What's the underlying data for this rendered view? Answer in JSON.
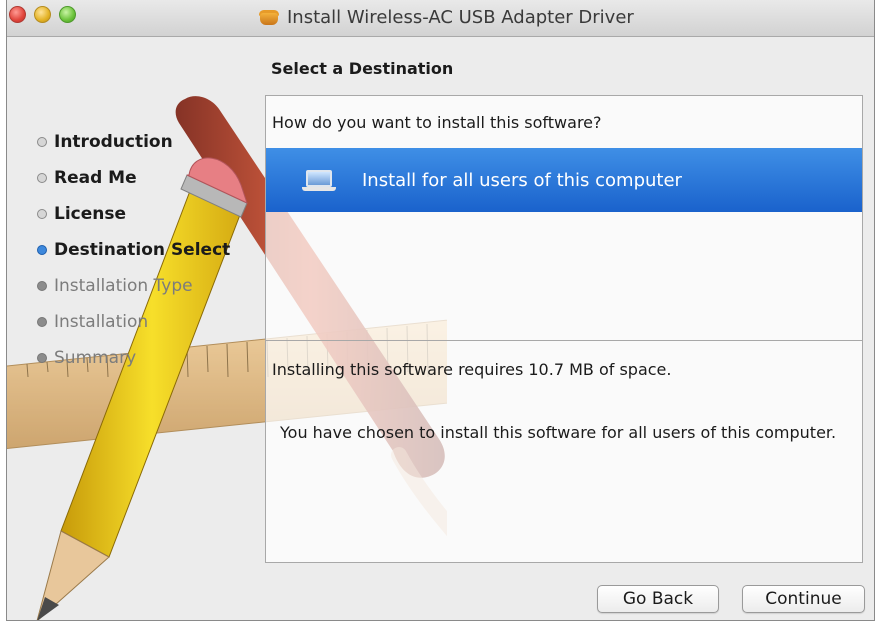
{
  "window": {
    "title": "Install Wireless-AC USB Adapter Driver",
    "title_icon": "package-icon"
  },
  "sidebar": {
    "steps": [
      {
        "label": "Introduction",
        "state": "done"
      },
      {
        "label": "Read Me",
        "state": "done"
      },
      {
        "label": "License",
        "state": "done"
      },
      {
        "label": "Destination Select",
        "state": "current"
      },
      {
        "label": "Installation Type",
        "state": "future"
      },
      {
        "label": "Installation",
        "state": "future"
      },
      {
        "label": "Summary",
        "state": "future"
      }
    ]
  },
  "main": {
    "heading": "Select a Destination",
    "question": "How do you want to install this software?",
    "selected_option": "Install for all users of this computer",
    "space_note": "Installing this software requires 10.7 MB of space.",
    "choice_note": "You have chosen to install this software for all users of this computer."
  },
  "buttons": {
    "back": "Go Back",
    "continue": "Continue"
  },
  "colors": {
    "selection": "#1a62cc",
    "current_step_dot": "#3d88dc"
  }
}
